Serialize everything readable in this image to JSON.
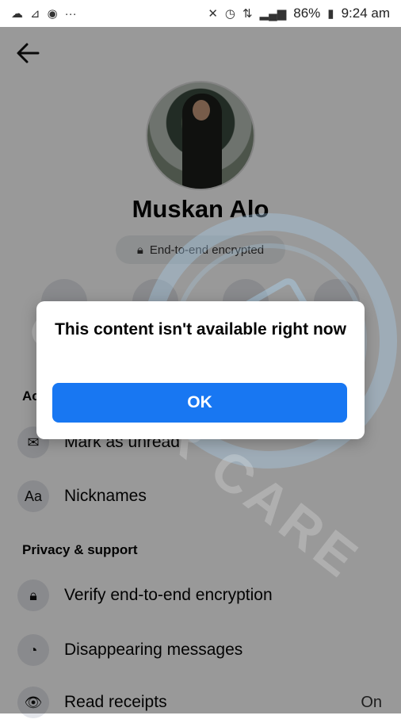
{
  "status_bar": {
    "battery": "86%",
    "time": "9:24 am"
  },
  "profile": {
    "name": "Muskan Alo",
    "encryption_badge": "End-to-end encrypted"
  },
  "sections": {
    "actions_header_partial": "Ac",
    "privacy_header": "Privacy & support"
  },
  "rows": [
    {
      "label": "Mark as unread",
      "icon": "mark-unread-icon"
    },
    {
      "label": "Nicknames",
      "icon_text": "Aa",
      "icon": "nicknames-icon"
    },
    {
      "label": "Verify end-to-end encryption",
      "icon": "lock-icon"
    },
    {
      "label": "Disappearing messages",
      "icon": "timer-icon"
    },
    {
      "label": "Read receipts",
      "value": "On",
      "icon": "eye-icon"
    }
  ],
  "dialog": {
    "message": "This content isn't available right now",
    "ok_label": "OK"
  },
  "watermark": {
    "text": "CYBER CARE"
  },
  "colors": {
    "accent": "#1877f2",
    "scrim": "rgba(0,0,0,0.40)"
  }
}
